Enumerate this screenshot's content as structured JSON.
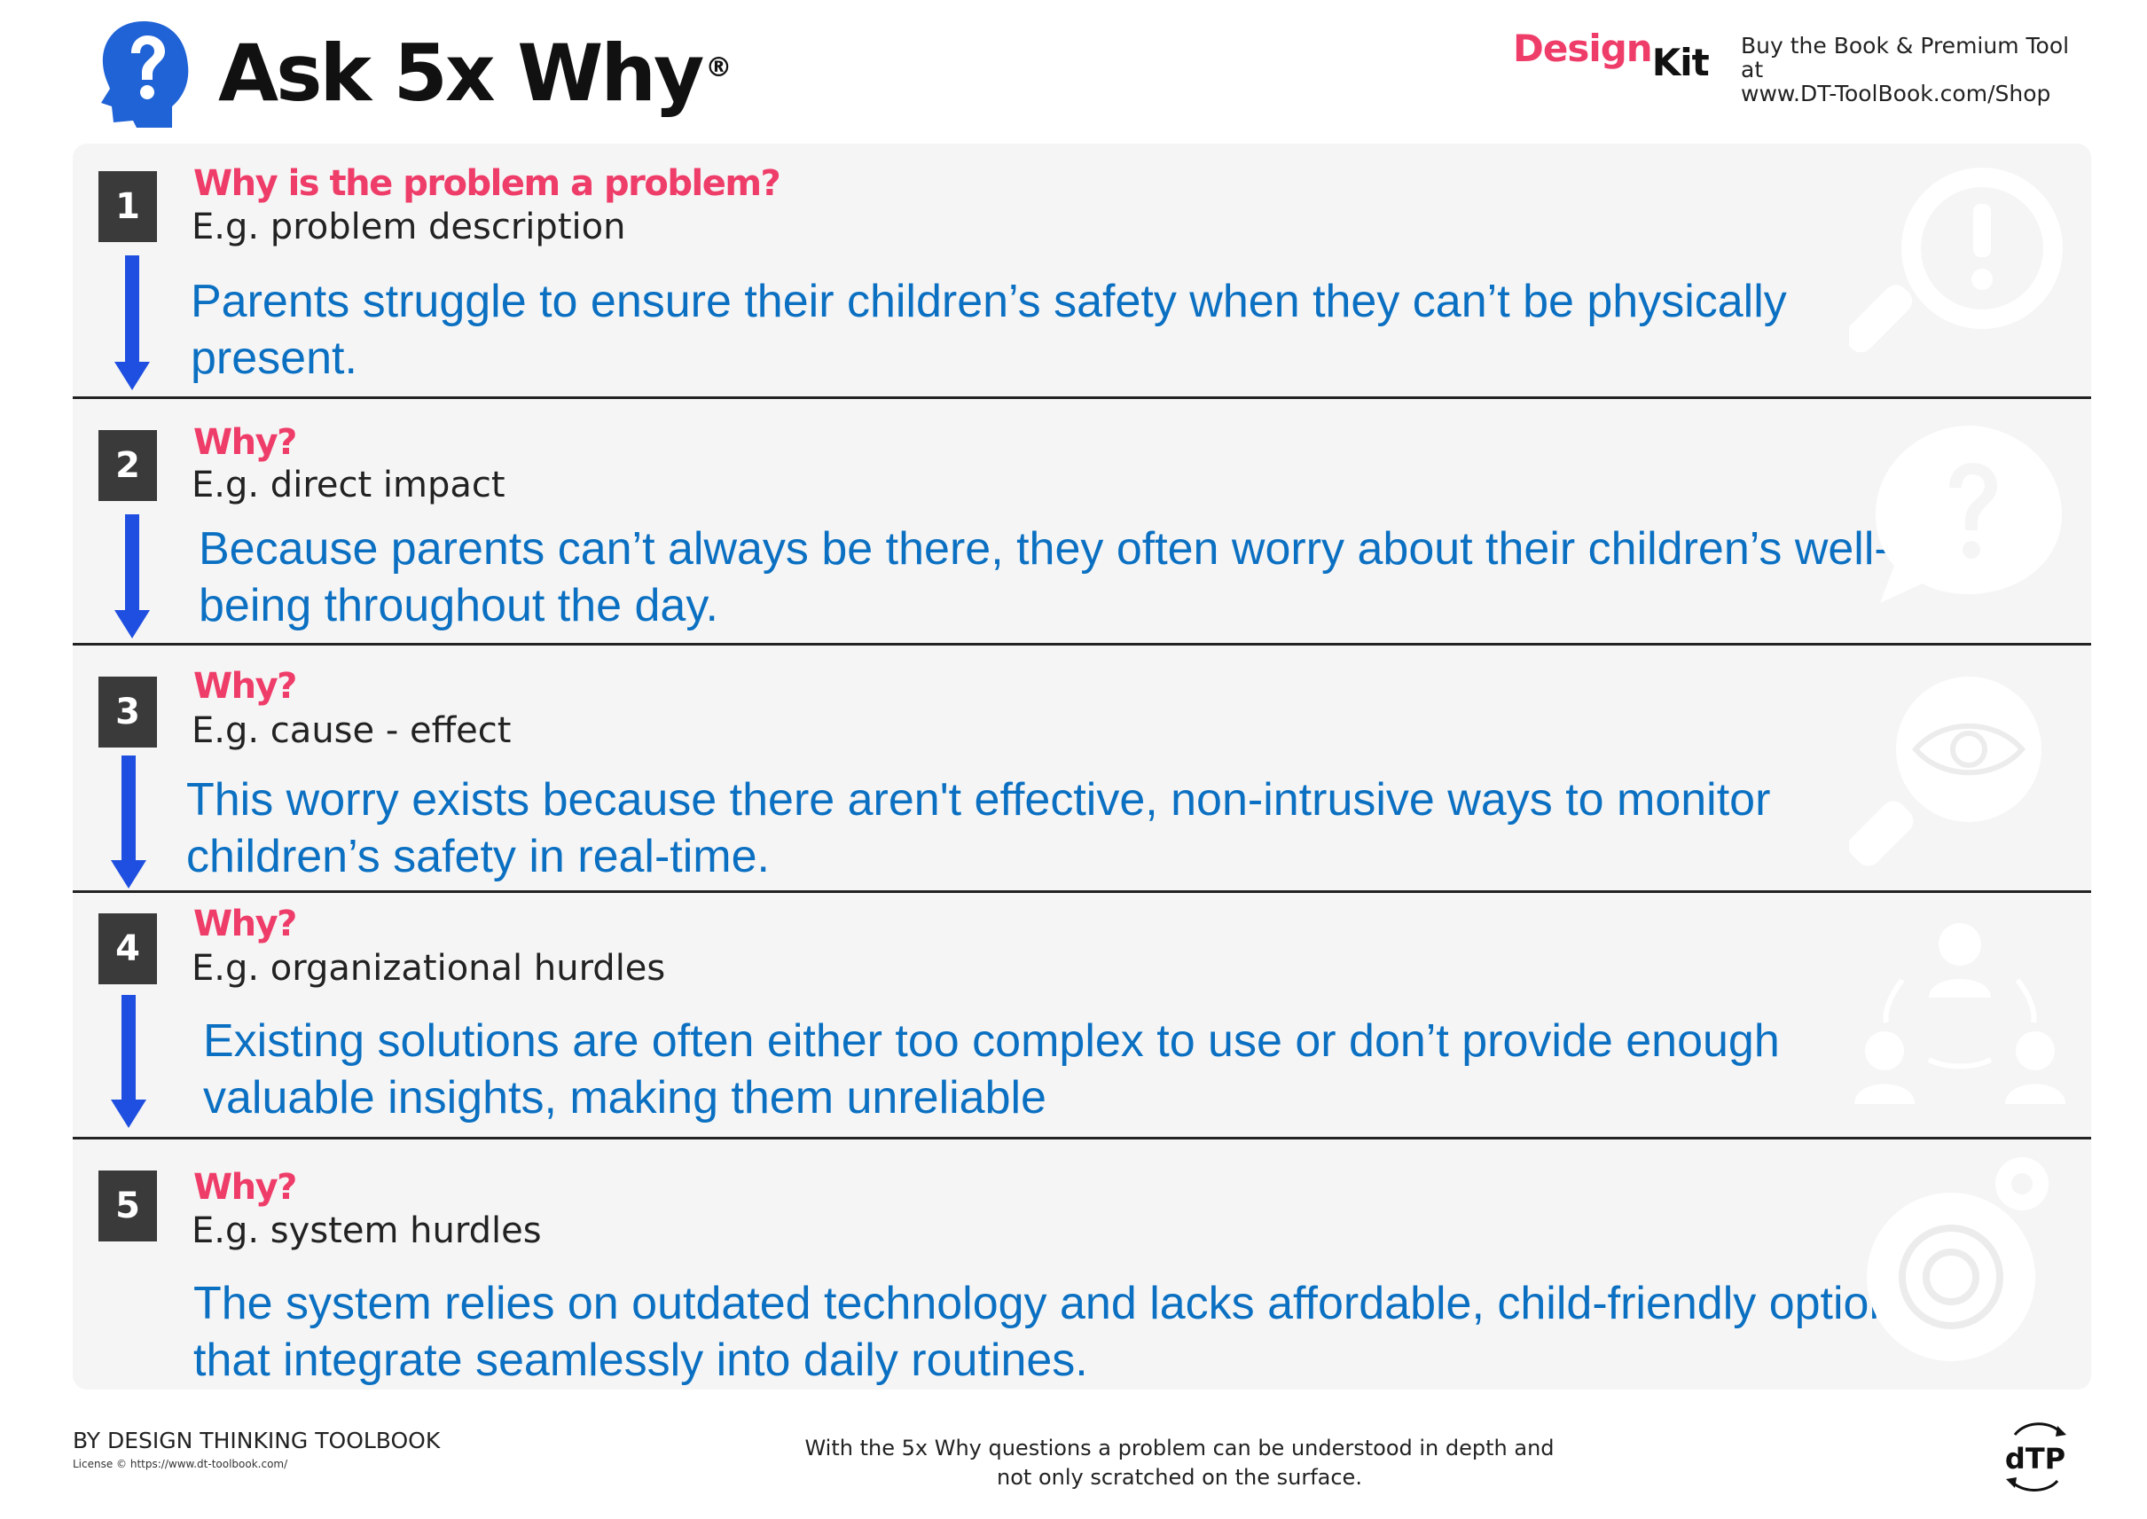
{
  "header": {
    "title": "Ask 5x Why",
    "registered_mark": "®",
    "brand_design": "Design",
    "brand_kit": "Kit",
    "buy_line1": "Buy the Book & Premium Tool",
    "buy_line2": "at",
    "buy_line3": "www.DT-ToolBook.com/Shop"
  },
  "colors": {
    "accent_pink": "#ef3d6a",
    "answer_blue": "#0b70c2",
    "arrow_blue": "#1f4fe0",
    "badge_gray": "#3a3a3a"
  },
  "steps": [
    {
      "number": "1",
      "question": "Why is the problem a problem?",
      "example": "E.g. problem description",
      "answer": "Parents struggle to ensure their children’s safety when they can’t be physically present.",
      "icon": "magnifier-exclamation-icon"
    },
    {
      "number": "2",
      "question": "Why?",
      "example": "E.g. direct impact",
      "answer": "Because parents can’t always be there, they often worry about their children’s well-being throughout the day.",
      "icon": "question-bubble-icon"
    },
    {
      "number": "3",
      "question": "Why?",
      "example": "E.g. cause - effect",
      "answer": "This worry exists because there aren't effective, non-intrusive ways to monitor children’s safety in real-time.",
      "icon": "eye-magnifier-icon"
    },
    {
      "number": "4",
      "question": "Why?",
      "example": "E.g. organizational hurdles",
      "answer": "Existing solutions are often either too complex to use or don’t provide enough valuable insights, making them unreliable",
      "icon": "people-network-icon"
    },
    {
      "number": "5",
      "question": "Why?",
      "example": "E.g. system hurdles",
      "answer": "The system relies on outdated technology and lacks affordable, child-friendly options that integrate seamlessly into daily routines.",
      "icon": "gear-system-icon"
    }
  ],
  "footer": {
    "by": "BY DESIGN THINKING TOOLBOOK",
    "license": "License © https://www.dt-toolbook.com/",
    "note": "With the 5x Why questions a problem can be  understood in depth and not only scratched on the surface.",
    "logo_text": "dTP"
  }
}
